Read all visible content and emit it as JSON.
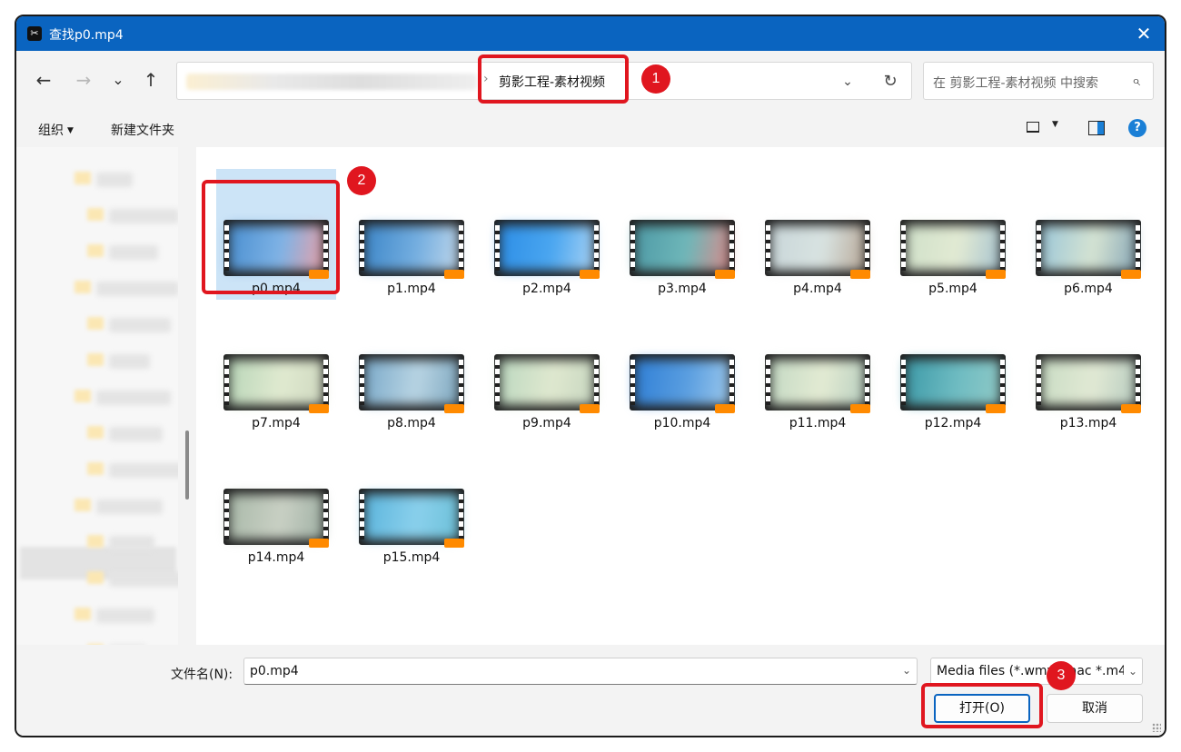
{
  "window": {
    "title": "查找p0.mp4",
    "app_icon": "capcut-icon",
    "close_glyph": "✕"
  },
  "nav": {
    "back_glyph": "←",
    "forward_glyph": "→",
    "recent_glyph": "⌄",
    "up_glyph": "↑",
    "address_separator": "›",
    "current_folder": "剪影工程-素材视频",
    "dropdown_glyph": "⌄",
    "refresh_glyph": "↻",
    "search_placeholder": "在 剪影工程-素材视频 中搜索",
    "search_glyph": "⌕"
  },
  "toolbar": {
    "organize_label": "组织",
    "caret": "▼",
    "new_folder_label": "新建文件夹",
    "help_glyph": "?"
  },
  "files": [
    {
      "name": "p0.mp4",
      "selected": true,
      "colors": [
        "#4a8fd0",
        "#7fb3e6",
        "#e8a0a8"
      ]
    },
    {
      "name": "p1.mp4",
      "colors": [
        "#3c86c8",
        "#74aee0",
        "#bfd6ea"
      ]
    },
    {
      "name": "p2.mp4",
      "colors": [
        "#2d8ee6",
        "#4aa6f0",
        "#a8d2f4"
      ]
    },
    {
      "name": "p3.mp4",
      "colors": [
        "#4e9aa6",
        "#6fb7b9",
        "#d98a8a"
      ]
    },
    {
      "name": "p4.mp4",
      "colors": [
        "#c9d6d9",
        "#d8e3e1",
        "#b9a999"
      ]
    },
    {
      "name": "p5.mp4",
      "colors": [
        "#cfe0c9",
        "#e2ead3",
        "#a8c4d0"
      ]
    },
    {
      "name": "p6.mp4",
      "colors": [
        "#9cc7d8",
        "#d5e3d2",
        "#8aa9b8"
      ]
    },
    {
      "name": "p7.mp4",
      "colors": [
        "#b9d6b9",
        "#e0ead0",
        "#cfd8c0"
      ]
    },
    {
      "name": "p8.mp4",
      "colors": [
        "#7aa9c9",
        "#b8d4e3",
        "#7fa8c0"
      ]
    },
    {
      "name": "p9.mp4",
      "colors": [
        "#bcd8c0",
        "#dfe8cf",
        "#c7d6c0"
      ]
    },
    {
      "name": "p10.mp4",
      "colors": [
        "#2f7fd6",
        "#5a9ee0",
        "#9cc8ec"
      ]
    },
    {
      "name": "p11.mp4",
      "colors": [
        "#c4d9c4",
        "#e3ebd3",
        "#b9cfc0"
      ]
    },
    {
      "name": "p12.mp4",
      "colors": [
        "#3d9aa8",
        "#6fbcc2",
        "#8fc9c6"
      ]
    },
    {
      "name": "p13.mp4",
      "colors": [
        "#c9dcc4",
        "#e1e9d4",
        "#b8ccc0"
      ]
    },
    {
      "name": "p14.mp4",
      "colors": [
        "#a9b9a9",
        "#c9d0c4",
        "#9fb0a4"
      ]
    },
    {
      "name": "p15.mp4",
      "colors": [
        "#5bb4dc",
        "#8ad0ec",
        "#6cc0d8"
      ]
    }
  ],
  "footer": {
    "filename_label": "文件名(N):",
    "filename_value": "p0.mp4",
    "filetype_value": "Media files (*.wmv *.aac *.m4",
    "open_label": "打开(O)",
    "cancel_label": "取消",
    "caret_glyph": "⌄"
  },
  "annotations": [
    "1",
    "2",
    "3"
  ],
  "colors": {
    "title_bar": "#0a64c0",
    "selection": "#cce4f7",
    "highlight": "#e0161f",
    "accent": "#1a7fd6"
  }
}
